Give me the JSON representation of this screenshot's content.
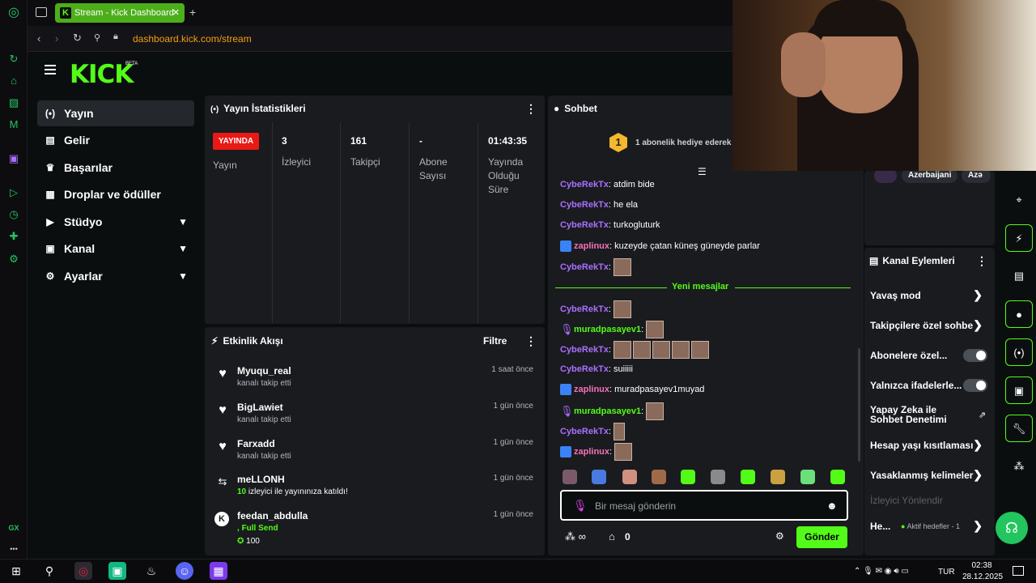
{
  "browser": {
    "tab_title": "Stream - Kick Dashboard",
    "tab_new": "+",
    "url": "dashboard.kick.com/stream",
    "gx_label": "GX",
    "gx_more": "•••"
  },
  "brand": {
    "logo": "KICK",
    "beta": "BETA"
  },
  "nav": [
    {
      "label": "Yayın",
      "icon": "broadcast-icon"
    },
    {
      "label": "Gelir",
      "icon": "chart-icon"
    },
    {
      "label": "Başarılar",
      "icon": "trophy-icon"
    },
    {
      "label": "Droplar ve ödüller",
      "icon": "gift-icon"
    },
    {
      "label": "Stüdyo",
      "icon": "play-icon"
    },
    {
      "label": "Kanal",
      "icon": "user-icon"
    },
    {
      "label": "Ayarlar",
      "icon": "gear-icon"
    }
  ],
  "stats": {
    "title": "Yayın İstatistikleri",
    "live_badge": "YAYINDA",
    "live_label": "Yayın",
    "items": [
      {
        "value": "3",
        "label": "İzleyici"
      },
      {
        "value": "161",
        "label": "Takipçi"
      },
      {
        "value": "-",
        "label": "Abone Sayısı"
      },
      {
        "value": "01:43:35",
        "label": "Yayında Olduğu Süre"
      }
    ]
  },
  "activity": {
    "title": "Etkinlik Akışı",
    "filter": "Filtre",
    "items": [
      {
        "name": "Myuqu_real",
        "sub": "kanalı takip etti",
        "time": "1 saat önce",
        "icon": "heart-icon"
      },
      {
        "name": "BigLawiet",
        "sub": "kanalı takip etti",
        "time": "1 gün önce",
        "icon": "heart-icon"
      },
      {
        "name": "Farxadd",
        "sub": "kanalı takip etti",
        "time": "1 gün önce",
        "icon": "heart-icon"
      },
      {
        "name": "meLLONH",
        "sub_count": "10",
        "sub": " izleyici ile yayınınıza katıldı!",
        "time": "1 gün önce",
        "icon": "host-icon"
      },
      {
        "name": "feedan_abdulla",
        "sub_prefix": ", ",
        "sub": "Full Send",
        "time": "1 gün önce",
        "icon": "kick-icon",
        "amount": "100"
      }
    ]
  },
  "chat": {
    "title": "Sohbet",
    "gift_count": "1",
    "gift_text": "1 abonelik hediye ederek",
    "new_messages": "Yeni mesajlar",
    "messages": [
      {
        "user": "CybeRekTx",
        "text": "atdim bide"
      },
      {
        "user": "CybeRekTx",
        "text": "he ela"
      },
      {
        "user": "CybeRekTx",
        "text": "turkogluturk"
      },
      {
        "user": "zaplinux",
        "text": "kuzeyde çatan küneş güneyde parlar"
      },
      {
        "user": "CybeRekTx",
        "text": ""
      },
      {
        "user": "CybeRekTx",
        "text": ""
      },
      {
        "user": "muradpasayev1",
        "text": ""
      },
      {
        "user": "CybeRekTx",
        "text": ""
      },
      {
        "user": "CybeRekTx",
        "text": "suiiiii"
      },
      {
        "user": "zaplinux",
        "text": "muradpasayev1muyad"
      },
      {
        "user": "muradpasayev1",
        "text": ""
      },
      {
        "user": "CybeRekTx",
        "text": ""
      },
      {
        "user": "zaplinux",
        "text": ""
      }
    ],
    "input_placeholder": "Bir mesaj gönderin",
    "points": "0",
    "send": "Gönder"
  },
  "right": {
    "tags": [
      "Azerbaijani",
      "Azə"
    ],
    "actions_title": "Kanal Eylemleri",
    "actions": [
      {
        "label": "Yavaş mod",
        "type": "arrow"
      },
      {
        "label": "Takipçilere özel sohbe",
        "type": "arrow"
      },
      {
        "label": "Abonelere özel...",
        "type": "toggle"
      },
      {
        "label": "Yalnızca ifadelerle...",
        "type": "toggle"
      },
      {
        "label": "Yapay Zeka ile Sohbet Denetimi",
        "type": "external"
      },
      {
        "label": "Hesap yaşı kısıtlaması",
        "type": "arrow"
      },
      {
        "label": "Yasaklanmış kelimeler",
        "type": "arrow"
      },
      {
        "label": "İzleyici Yönlendir",
        "type": "disabled"
      },
      {
        "label": "He...",
        "type": "arrow",
        "extra": "Aktif hedefler - 1"
      }
    ]
  },
  "taskbar": {
    "lang": "TUR",
    "time": "02:38",
    "date": "28.12.2025"
  },
  "colors": {
    "accent": "#53fc18",
    "live": "#e91916",
    "panel": "#191b1f"
  }
}
